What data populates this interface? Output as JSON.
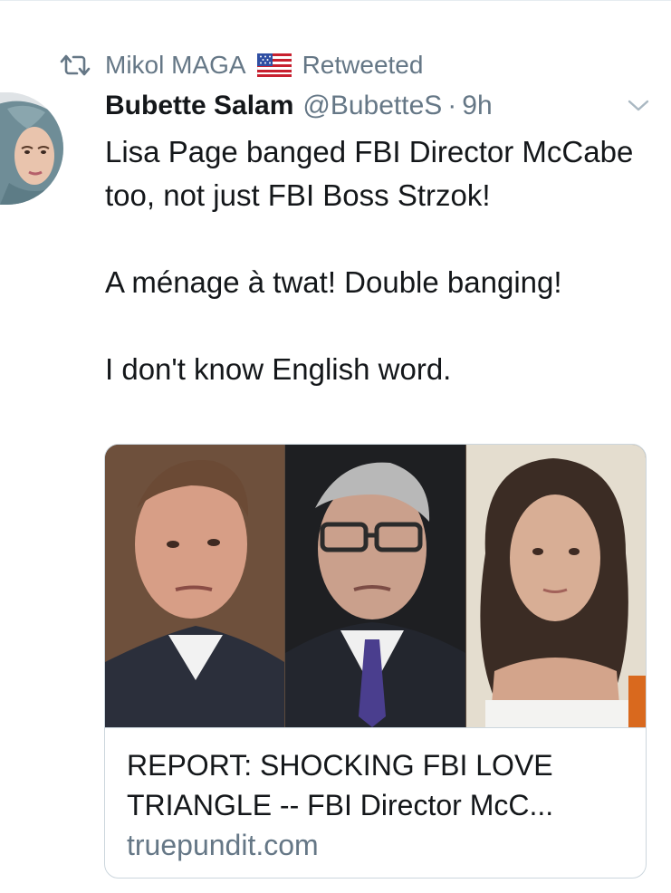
{
  "retweet": {
    "icon": "retweet-icon",
    "retweeter_name": "Mikol MAGA",
    "flag_icon": "us-flag-icon",
    "label": "Retweeted"
  },
  "tweet": {
    "avatar": "avatar-woman-hijab",
    "display_name": "Bubette Salam",
    "handle": "@BubetteS",
    "separator": "·",
    "time": "9h",
    "menu_icon": "chevron-down-icon",
    "paragraphs": [
      "Lisa Page banged FBI Director McCabe too, not just FBI Boss Strzok!",
      "A ménage à twat! Double banging!",
      "I don't know English word."
    ]
  },
  "card": {
    "image": "three-portraits-photo",
    "title": "REPORT: SHOCKING FBI LOVE TRIANGLE -- FBI Director McC...",
    "domain": "truepundit.com"
  },
  "colors": {
    "text": "#14171a",
    "secondary": "#657786",
    "border": "#ccd6dd"
  }
}
